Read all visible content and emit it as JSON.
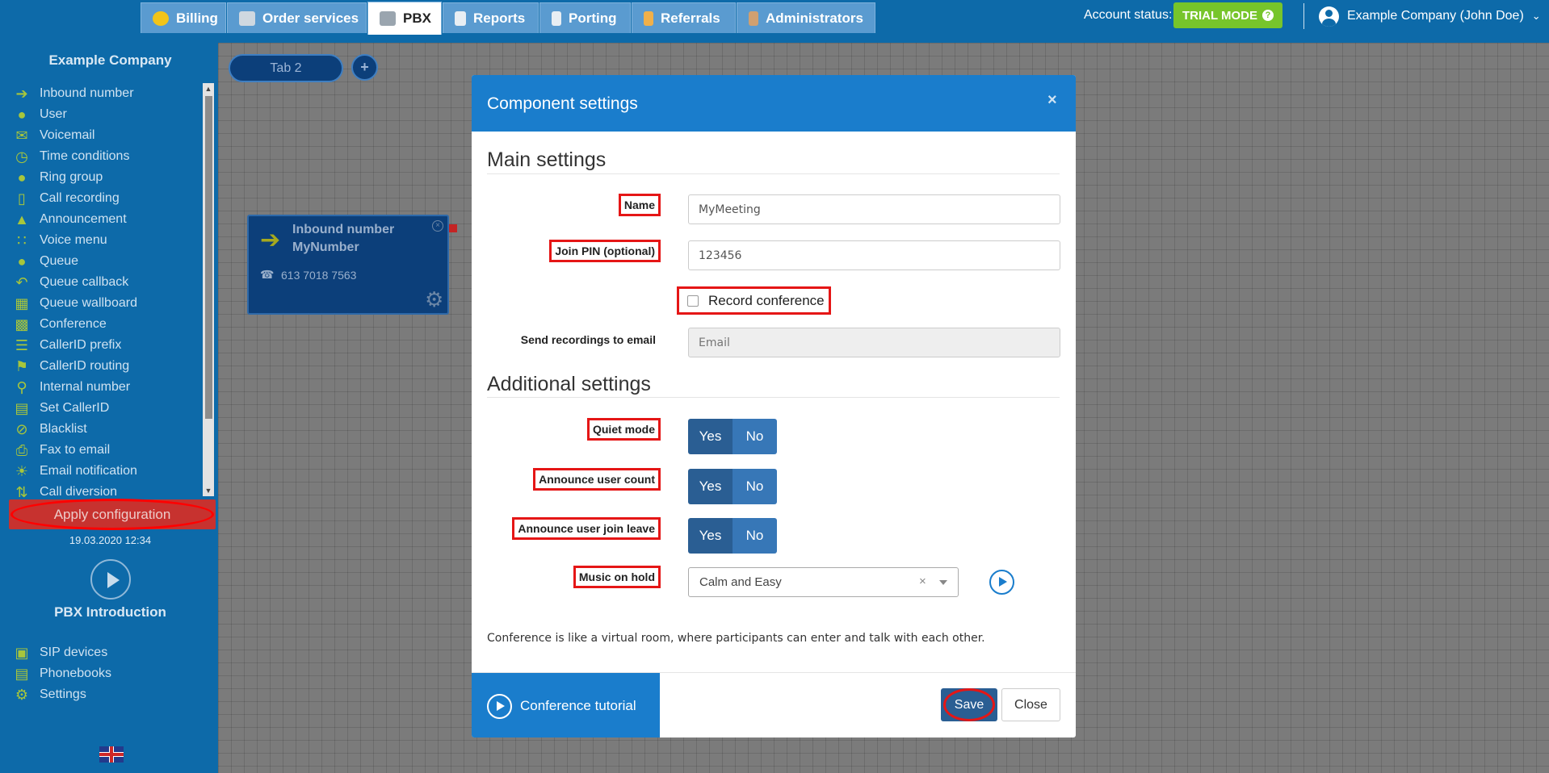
{
  "nav": {
    "tabs": [
      {
        "label": "Billing"
      },
      {
        "label": "Order services"
      },
      {
        "label": "PBX"
      },
      {
        "label": "Reports"
      },
      {
        "label": "Porting"
      },
      {
        "label": "Referrals"
      },
      {
        "label": "Administrators"
      }
    ],
    "active_tab": "PBX",
    "account_status_label": "Account status:",
    "trial_badge": "TRIAL MODE",
    "user_name": "Example Company (John Doe)"
  },
  "sidebar": {
    "company": "Example Company",
    "components": [
      {
        "label": "Inbound number",
        "icon": "arrow-right-icon"
      },
      {
        "label": "User",
        "icon": "user-icon"
      },
      {
        "label": "Voicemail",
        "icon": "envelope-icon"
      },
      {
        "label": "Time conditions",
        "icon": "clock-icon"
      },
      {
        "label": "Ring group",
        "icon": "group-icon"
      },
      {
        "label": "Call recording",
        "icon": "microphone-icon"
      },
      {
        "label": "Announcement",
        "icon": "megaphone-icon"
      },
      {
        "label": "Voice menu",
        "icon": "grid-icon"
      },
      {
        "label": "Queue",
        "icon": "user-plus-icon"
      },
      {
        "label": "Queue callback",
        "icon": "callback-icon"
      },
      {
        "label": "Queue wallboard",
        "icon": "table-icon"
      },
      {
        "label": "Conference",
        "icon": "chat-icon"
      },
      {
        "label": "CallerID prefix",
        "icon": "list-icon"
      },
      {
        "label": "CallerID routing",
        "icon": "sitemap-icon"
      },
      {
        "label": "Internal number",
        "icon": "map-pin-icon"
      },
      {
        "label": "Set CallerID",
        "icon": "id-card-icon"
      },
      {
        "label": "Blacklist",
        "icon": "ban-icon"
      },
      {
        "label": "Fax to email",
        "icon": "printer-icon"
      },
      {
        "label": "Email notification",
        "icon": "bell-icon"
      },
      {
        "label": "Call diversion",
        "icon": "diversion-icon"
      }
    ],
    "apply_button": "Apply configuration",
    "apply_date": "19.03.2020 12:34",
    "intro_label": "PBX Introduction",
    "bottom_links": [
      {
        "label": "SIP devices",
        "icon": "monitor-icon"
      },
      {
        "label": "Phonebooks",
        "icon": "book-icon"
      },
      {
        "label": "Settings",
        "icon": "gear-icon"
      }
    ]
  },
  "canvas": {
    "tab_label": "Tab 2",
    "node": {
      "type_label": "Inbound number",
      "name": "MyNumber",
      "number": "613 7018 7563"
    }
  },
  "modal": {
    "title": "Component settings",
    "main_section": "Main settings",
    "name_label": "Name",
    "name_value": "MyMeeting",
    "pin_label": "Join PIN (optional)",
    "pin_value": "123456",
    "record_label": "Record conference",
    "email_label": "Send recordings to email",
    "email_placeholder": "Email",
    "additional_section": "Additional settings",
    "quiet_label": "Quiet mode",
    "announce_count_label": "Announce user count",
    "announce_join_label": "Announce user join leave",
    "yes": "Yes",
    "no": "No",
    "moh_label": "Music on hold",
    "moh_value": "Calm and Easy",
    "description": "Conference is like a virtual room, where participants can enter and talk with each other.",
    "tutorial_label": "Conference tutorial",
    "save_label": "Save",
    "close_label": "Close"
  },
  "colors": {
    "primary": "#1a7dcc",
    "sidebar": "#0d6aa9",
    "trial": "#77c52b",
    "apply": "#c7322f",
    "highlight": "#e51616"
  }
}
